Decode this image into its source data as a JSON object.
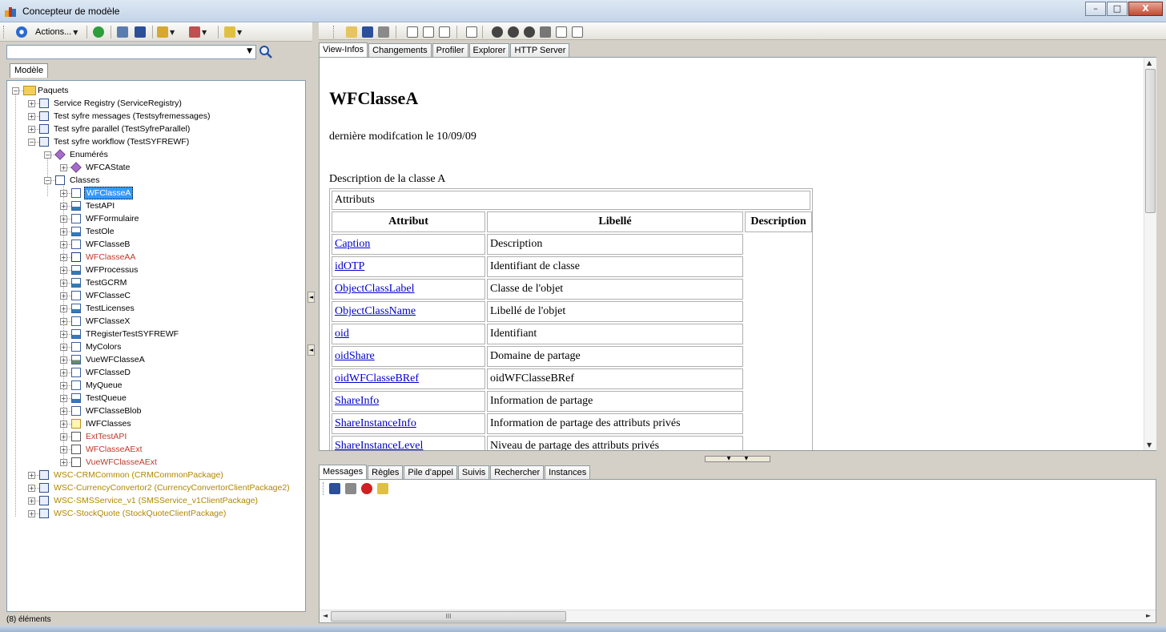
{
  "window": {
    "title": "Concepteur de modèle",
    "minimize": "–",
    "maximize": "□",
    "close": "X"
  },
  "left_toolbar": {
    "actions_label": "Actions..."
  },
  "search": {
    "value": "",
    "placeholder": ""
  },
  "left_tab": "Modèle",
  "tree": {
    "root": "Paquets",
    "packages_top": [
      "Service Registry (ServiceRegistry)",
      "Test syfre messages (Testsyfremessages)",
      "Test syfre parallel (TestSyfreParallel)",
      "Test syfre workflow (TestSYFREWF)"
    ],
    "enum_folder": "Enumérés",
    "enum_items": [
      "WFCAState"
    ],
    "classes_folder": "Classes",
    "classes": [
      {
        "label": "WFClasseA",
        "icon": "class-icon",
        "selected": true,
        "color": "#000000"
      },
      {
        "label": "TestAPI",
        "icon": "service-class-icon",
        "color": "#000000"
      },
      {
        "label": "WFFormulaire",
        "icon": "class-icon",
        "color": "#000000"
      },
      {
        "label": "TestOle",
        "icon": "service-class-icon",
        "color": "#000000"
      },
      {
        "label": "WFClasseB",
        "icon": "class-icon",
        "color": "#000000"
      },
      {
        "label": "WFClasseAA",
        "icon": "derived-class-icon",
        "color": "#c0392b"
      },
      {
        "label": "WFProcessus",
        "icon": "service-class-icon",
        "color": "#000000"
      },
      {
        "label": "TestGCRM",
        "icon": "service-class-icon",
        "color": "#000000"
      },
      {
        "label": "WFClasseC",
        "icon": "class-icon",
        "color": "#000000"
      },
      {
        "label": "TestLicenses",
        "icon": "service-class-icon",
        "color": "#000000"
      },
      {
        "label": "WFClasseX",
        "icon": "class-icon",
        "color": "#000000"
      },
      {
        "label": "TRegisterTestSYFREWF",
        "icon": "service-class-icon",
        "color": "#000000"
      },
      {
        "label": "MyColors",
        "icon": "class-icon",
        "color": "#000000"
      },
      {
        "label": "VueWFClasseA",
        "icon": "view-class-icon",
        "color": "#000000"
      },
      {
        "label": "WFClasseD",
        "icon": "class-icon",
        "color": "#000000"
      },
      {
        "label": "MyQueue",
        "icon": "class-icon",
        "color": "#000000"
      },
      {
        "label": "TestQueue",
        "icon": "service-class-icon",
        "color": "#000000"
      },
      {
        "label": "WFClasseBlob",
        "icon": "class-icon",
        "color": "#000000"
      },
      {
        "label": "IWFClasses",
        "icon": "interface-icon",
        "color": "#000000"
      },
      {
        "label": "ExtTestAPI",
        "icon": "extension-icon",
        "color": "#c0392b"
      },
      {
        "label": "WFClasseAExt",
        "icon": "extension-icon",
        "color": "#c0392b"
      },
      {
        "label": "VueWFClasseAExt",
        "icon": "extension-icon",
        "color": "#c0392b"
      }
    ],
    "packages_ws": [
      "WSC-CRMCommon (CRMCommonPackage)",
      "WSC-CurrencyConvertor2 (CurrencyConvertorClientPackage2)",
      "WSC-SMSService_v1 (SMSService_v1ClientPackage)",
      "WSC-StockQuote (StockQuoteClientPackage)"
    ],
    "ws_color": "#b08800"
  },
  "status": "(8) éléments",
  "right_tabs": [
    "View-Infos",
    "Changements",
    "Profiler",
    "Explorer",
    "HTTP Server"
  ],
  "doc": {
    "title": "WFClasseA",
    "modified": "dernière modifcation le 10/09/09",
    "description": "Description de la classe A",
    "attr_caption": "Attributs",
    "headers": [
      "Attribut",
      "Libellé",
      "Description"
    ],
    "rows": [
      [
        "Caption",
        "Description"
      ],
      [
        "idOTP",
        "Identifiant de classe"
      ],
      [
        "ObjectClassLabel",
        "Classe de l'objet"
      ],
      [
        "ObjectClassName",
        "Libellé de l'objet"
      ],
      [
        "oid",
        "Identifiant"
      ],
      [
        "oidShare",
        "Domaine de partage"
      ],
      [
        "oidWFClasseBRef",
        "oidWFClasseBRef"
      ],
      [
        "ShareInfo",
        "Information de partage"
      ],
      [
        "ShareInstanceInfo",
        "Information de partage des attributs privés"
      ],
      [
        "ShareInstanceLevel",
        "Niveau de partage des attributs privés"
      ]
    ]
  },
  "bottom_tabs": [
    "Messages",
    "Règles",
    "Pile d'appel",
    "Suivis",
    "Rechercher",
    "Instances"
  ],
  "scroll": {
    "hthumb_text": "III"
  }
}
